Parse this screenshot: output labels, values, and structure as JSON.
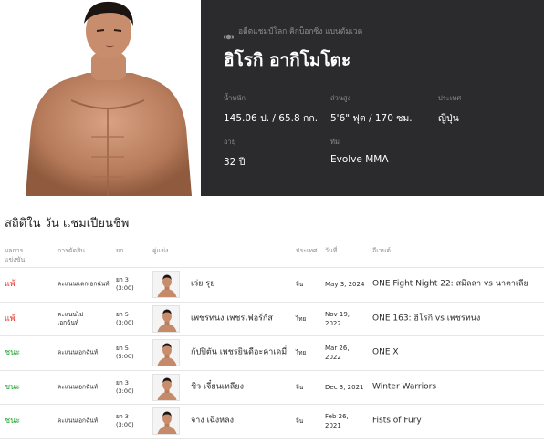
{
  "hero": {
    "badge": "อดีตแชมป์โลก คิกบ็อกซิ่ง แบนตัมเวต",
    "name": "ฮิโรกิ อากิโมโตะ",
    "stats": [
      {
        "label": "น้ำหนัก",
        "value": "145.06 ป. / 65.8 กก."
      },
      {
        "label": "ส่วนสูง",
        "value": "5'6\" ฟุต / 170 ซม."
      },
      {
        "label": "ประเทศ",
        "value": "ญี่ปุ่น"
      },
      {
        "label": "อายุ",
        "value": "32 ปี"
      },
      {
        "label": "ทีม",
        "value": "Evolve MMA"
      }
    ]
  },
  "record": {
    "title": "สถิติใน วัน แชมเปียนชิพ",
    "headers": {
      "result": "ผลการ\nแข่งขัน",
      "method": "การตัดสิน",
      "round": "ยก",
      "opponent": "คู่แข่ง",
      "country": "ประเทศ",
      "date": "วันที่",
      "event": "อีเวนต์"
    },
    "rows": [
      {
        "result": "แพ้",
        "outcome": "loss",
        "method": "คะแนนแตกเอกฉันท์",
        "round": "ยก 3\n(3:00)",
        "opponent": "เว่ย รุย",
        "country": "จีน",
        "date": "May 3, 2024",
        "event": "ONE Fight Night 22: สมิลลา vs นาตาเลีย"
      },
      {
        "result": "แพ้",
        "outcome": "loss",
        "method": "คะแนนไม่\nเอกฉันท์",
        "round": "ยก 5\n(3:00)",
        "opponent": "เพชรทนง เพชรเฟอร์กัส",
        "country": "ไทย",
        "date": "Nov 19,\n2022",
        "event": "ONE 163: ฮิโรกิ vs เพชรทนง"
      },
      {
        "result": "ชนะ",
        "outcome": "win",
        "method": "คะแนนเอกฉันท์",
        "round": "ยก 5\n(5:00)",
        "opponent": "กัปปิตัน เพชรยินดีอะคาเดมี่",
        "country": "ไทย",
        "date": "Mar 26,\n2022",
        "event": "ONE X"
      },
      {
        "result": "ชนะ",
        "outcome": "win",
        "method": "คะแนนเอกฉันท์",
        "round": "ยก 3\n(3:00)",
        "opponent": "ชิว เจี๋ยนเหลียง",
        "country": "จีน",
        "date": "Dec 3, 2021",
        "event": "Winter Warriors"
      },
      {
        "result": "ชนะ",
        "outcome": "win",
        "method": "คะแนนเอกฉันท์",
        "round": "ยก 3\n(3:00)",
        "opponent": "จาง เฉิงหลง",
        "country": "จีน",
        "date": "Feb 26, 2021",
        "event": "Fists of Fury"
      }
    ]
  },
  "colors": {
    "panel": "#2b2b2d",
    "win": "#1ea52d",
    "loss": "#e03a2f"
  },
  "icons": {
    "badge": "belt-icon"
  }
}
